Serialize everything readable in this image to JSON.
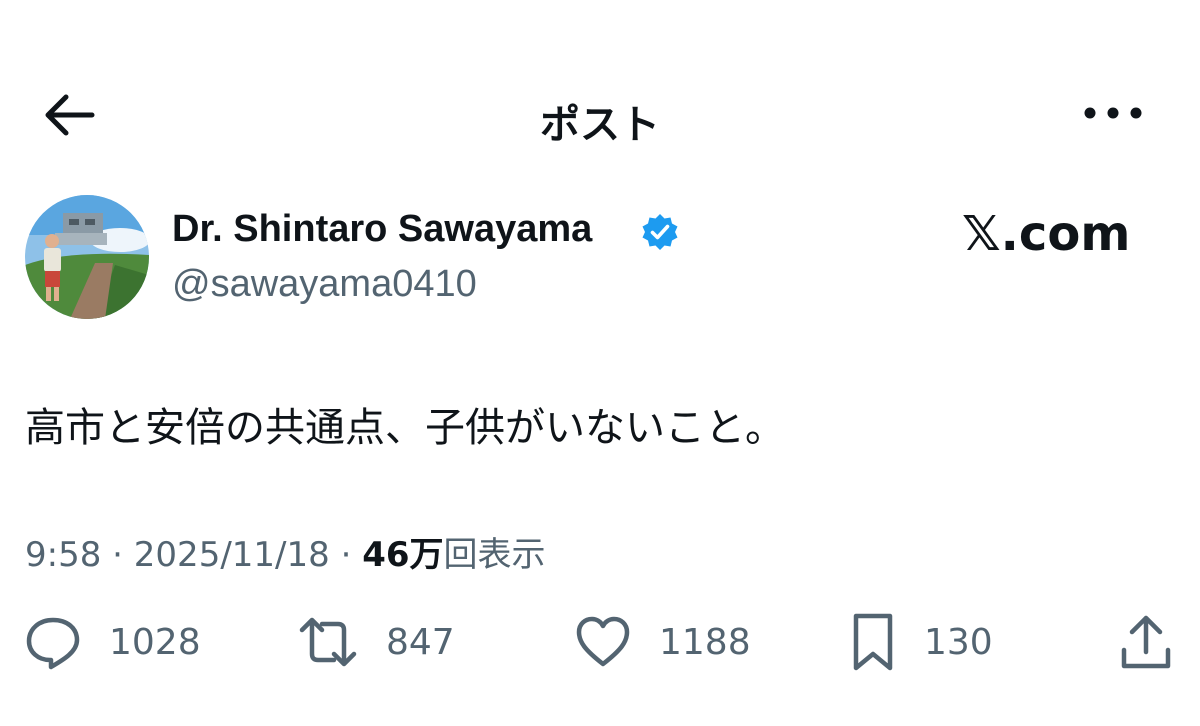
{
  "header": {
    "title": "ポスト",
    "back_icon": "arrow-left-icon",
    "more_icon": "more-horizontal-icon"
  },
  "author": {
    "name": "Dr. Shintaro Sawayama",
    "handle": "@sawayama0410",
    "verified": true,
    "verified_color": "#1d9bf0"
  },
  "brand": {
    "watermark": "𝕏.com"
  },
  "post": {
    "text": "高市と安倍の共通点、子供がいないこと。",
    "time": "9:58",
    "date": "2025/11/18",
    "views_count": "46万",
    "views_label": "回表示",
    "separator": " · "
  },
  "actions": {
    "replies": "1028",
    "reposts": "847",
    "likes": "1188",
    "bookmarks": "130"
  },
  "colors": {
    "text": "#0f1419",
    "secondary": "#536471",
    "background": "#ffffff"
  }
}
